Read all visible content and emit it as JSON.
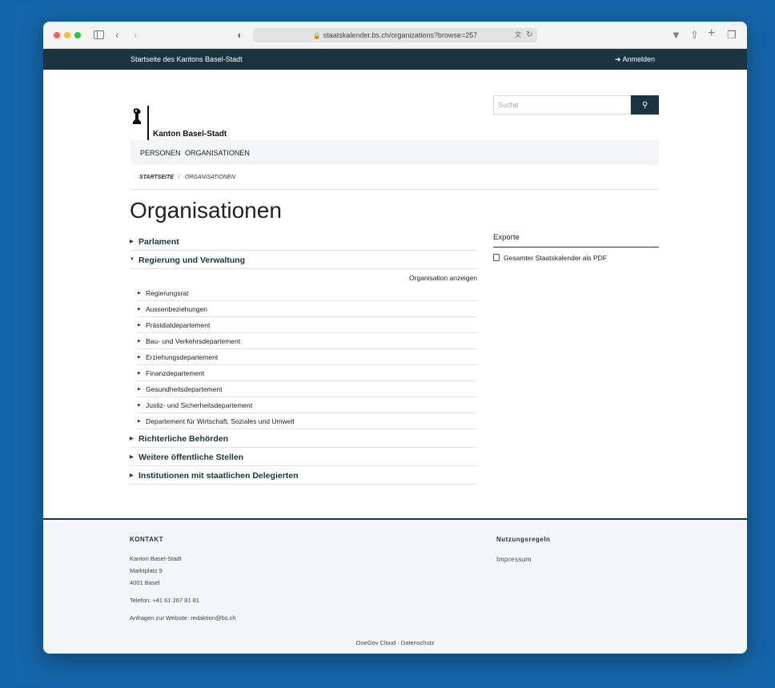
{
  "browser": {
    "url": "staatskalender.bs.ch/organizations?browse=257"
  },
  "site": {
    "home_link": "Startseite des Kantons Basel-Stadt",
    "login": "Anmelden",
    "logo_text": "Kanton Basel-Stadt",
    "search_placeholder": "Suche"
  },
  "nav": {
    "items": [
      "PERSONEN",
      "ORGANISATIONEN"
    ]
  },
  "breadcrumb": {
    "items": [
      "STARTSEITE",
      "ORGANISATIONEN"
    ],
    "separator": "/"
  },
  "page": {
    "title": "Organisationen"
  },
  "tree": {
    "top": [
      "Parlament",
      "Regierung und Verwaltung",
      "Richterliche Behörden",
      "Weitere öffentliche Stellen",
      "Institutionen mit staatlichen Delegierten"
    ],
    "show_org": "Organisation anzeigen",
    "sub": [
      "Regierungsrat",
      "Aussenbeziehungen",
      "Präsidialdepartement",
      "Bau- und Verkehrsdepartement",
      "Erziehungsdepartement",
      "Finanzdepartement",
      "Gesundheitsdepartement",
      "Justiz- und Sicherheitsdepartement",
      "Departement für Wirtschaft, Soziales und Umwelt"
    ]
  },
  "exports": {
    "title": "Exporte",
    "pdf": "Gesamter Staatskalender als PDF"
  },
  "footer": {
    "kontakt_title": "KONTAKT",
    "address": [
      "Kanton Basel-Stadt",
      "Marktplatz 9",
      "4001 Basel"
    ],
    "phone": "Telefon: +41 61 267 81 81",
    "website": "Anfragen zur Website: redaktion@bs.ch",
    "rules_title": "Nutzungsregeln",
    "impressum": "Impressum",
    "bottom": "OneGov Cloud · Datenschutz"
  },
  "colors": {
    "accent": "#1b3441",
    "background": "#1464a8"
  }
}
